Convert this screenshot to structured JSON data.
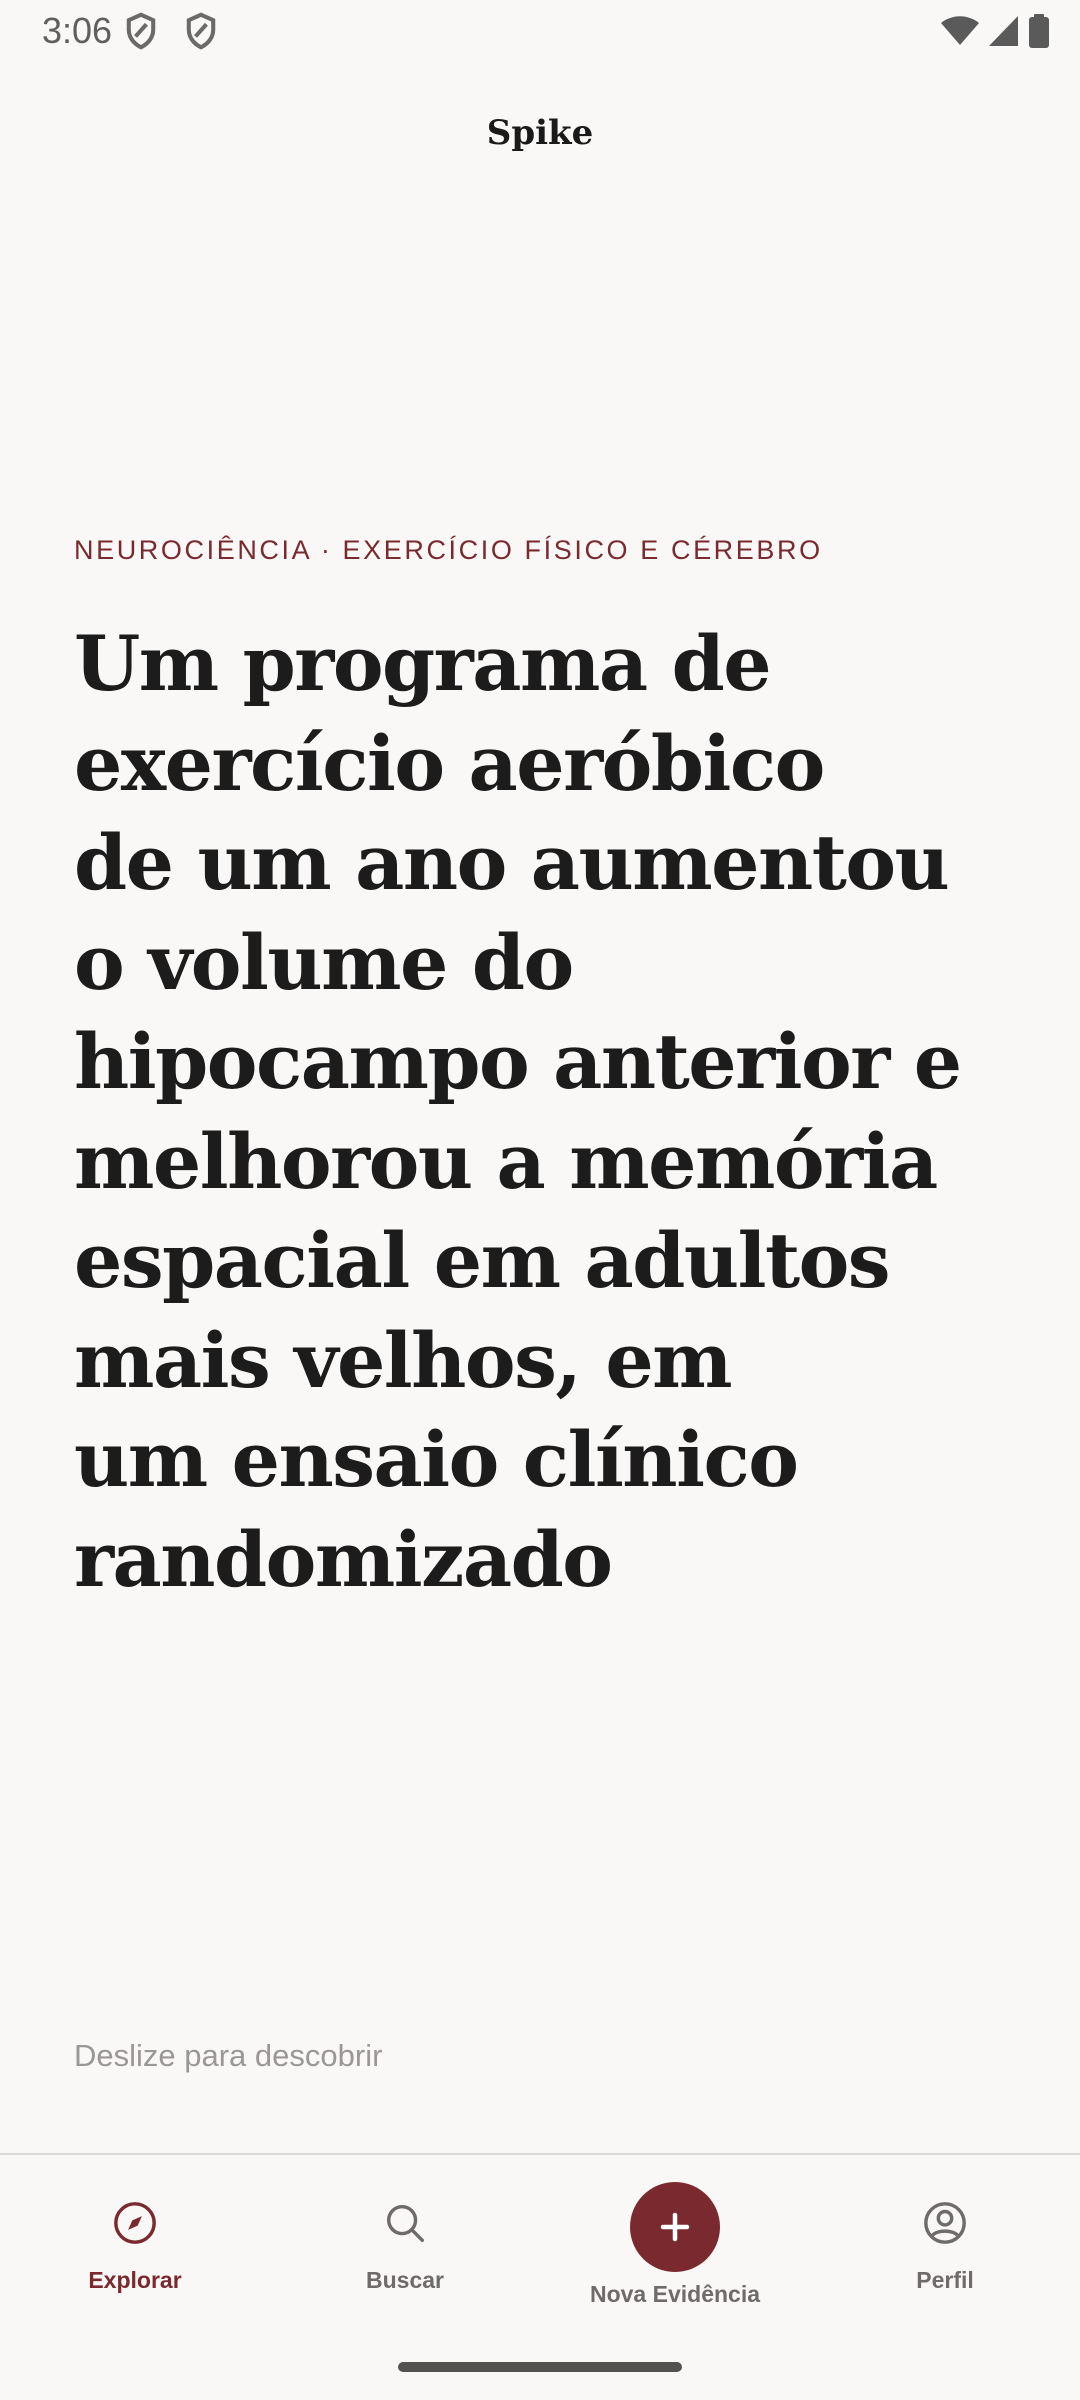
{
  "status_bar": {
    "time": "3:06",
    "left_icons": [
      "shield-icon",
      "shield-icon"
    ],
    "right_icons": [
      "wifi-icon",
      "cell-signal-icon",
      "battery-icon"
    ]
  },
  "header": {
    "title": "Spike"
  },
  "card": {
    "category": "NEUROCIÊNCIA · EXERCÍCIO FÍSICO E CÉREBRO",
    "headline_lines": [
      "Um programa de",
      "exercício aeróbico",
      "de um ano aumentou",
      "o volume do",
      "hipocampo anterior e",
      "melhorou a memória",
      "espacial em adultos",
      "mais velhos, em",
      "um ensaio clínico",
      "randomizado"
    ],
    "swipe_hint": "Deslize para descobrir"
  },
  "bottom_nav": {
    "items": [
      {
        "label": "Explorar",
        "icon": "compass-icon",
        "active": true
      },
      {
        "label": "Buscar",
        "icon": "search-icon",
        "active": false
      },
      {
        "label": "Nova Evidência",
        "icon": "plus-icon",
        "active": false
      },
      {
        "label": "Perfil",
        "icon": "profile-icon",
        "active": false
      }
    ]
  },
  "colors": {
    "accent": "#7a2a2f",
    "background": "#faf8f6",
    "text": "#1d1c1c",
    "muted": "#9a9796"
  }
}
